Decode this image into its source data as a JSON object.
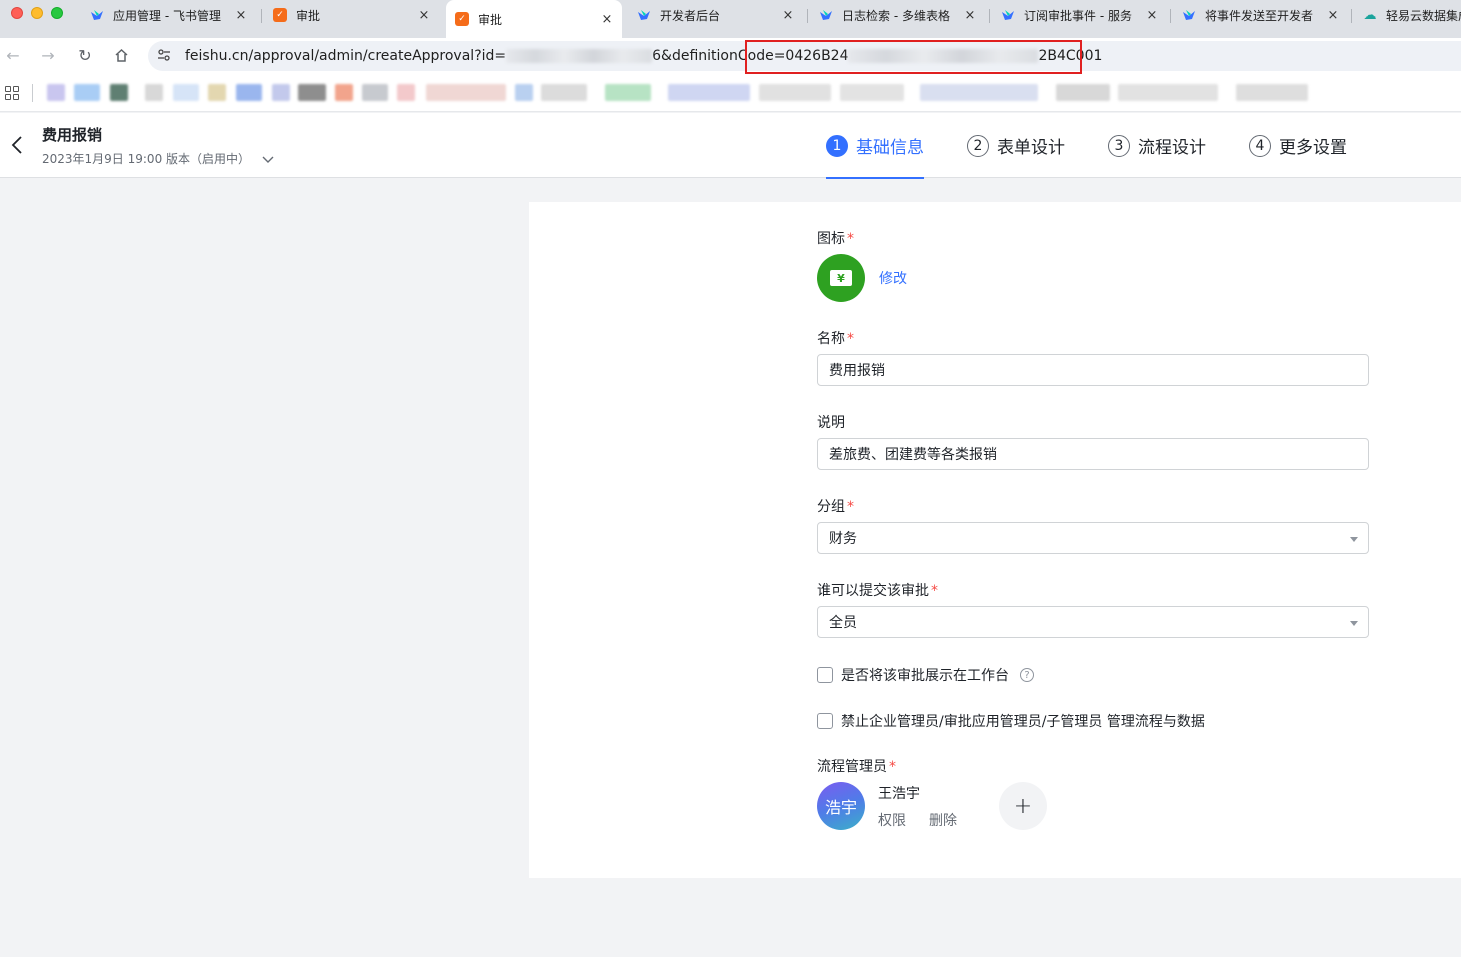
{
  "browser": {
    "tabs": [
      {
        "label": "应用管理 - 飞书管理",
        "icon": "feishu-icon",
        "close": "×"
      },
      {
        "label": "审批",
        "icon": "approval-icon",
        "close": "×"
      },
      {
        "label": "审批",
        "icon": "approval-icon",
        "close": "×"
      },
      {
        "label": "开发者后台",
        "icon": "feishu-icon",
        "close": "×"
      },
      {
        "label": "日志检索 - 多维表格",
        "icon": "feishu-icon",
        "close": "×"
      },
      {
        "label": "订阅审批事件 - 服务",
        "icon": "feishu-icon",
        "close": "×"
      },
      {
        "label": "将事件发送至开发者",
        "icon": "feishu-icon",
        "close": "×"
      },
      {
        "label": "轻易云数据集成",
        "icon": "cloud-icon"
      }
    ],
    "url": {
      "prefix": "feishu.cn/approval/admin/createApproval?id=",
      "middle": "6&definitionCode",
      "code_start": "=0426B24",
      "code_end": "2B4C001"
    }
  },
  "header": {
    "title": "费用报销",
    "version": "2023年1月9日 19:00 版本（启用中）",
    "steps": [
      {
        "num": "1",
        "label": "基础信息"
      },
      {
        "num": "2",
        "label": "表单设计"
      },
      {
        "num": "3",
        "label": "流程设计"
      },
      {
        "num": "4",
        "label": "更多设置"
      }
    ]
  },
  "form": {
    "icon_label": "图标",
    "icon_glyph": "¥",
    "modify": "修改",
    "name_label": "名称",
    "name_value": "费用报销",
    "desc_label": "说明",
    "desc_value": "差旅费、团建费等各类报销",
    "group_label": "分组",
    "group_value": "财务",
    "submitter_label": "谁可以提交该审批",
    "submitter_value": "全员",
    "show_workbench": "是否将该审批展示在工作台",
    "forbid_admin": "禁止企业管理员/审批应用管理员/子管理员 管理流程与数据",
    "admins_label": "流程管理员",
    "admin": {
      "avatar_text": "浩宇",
      "name": "王浩宇",
      "permission": "权限",
      "remove": "删除"
    },
    "required_mark": "*",
    "help_glyph": "?",
    "add_glyph": "+"
  },
  "colors": {
    "accent": "#3370ff",
    "icon_bg": "#2ea121",
    "required": "#f54a45",
    "highlight": "#e02020"
  }
}
